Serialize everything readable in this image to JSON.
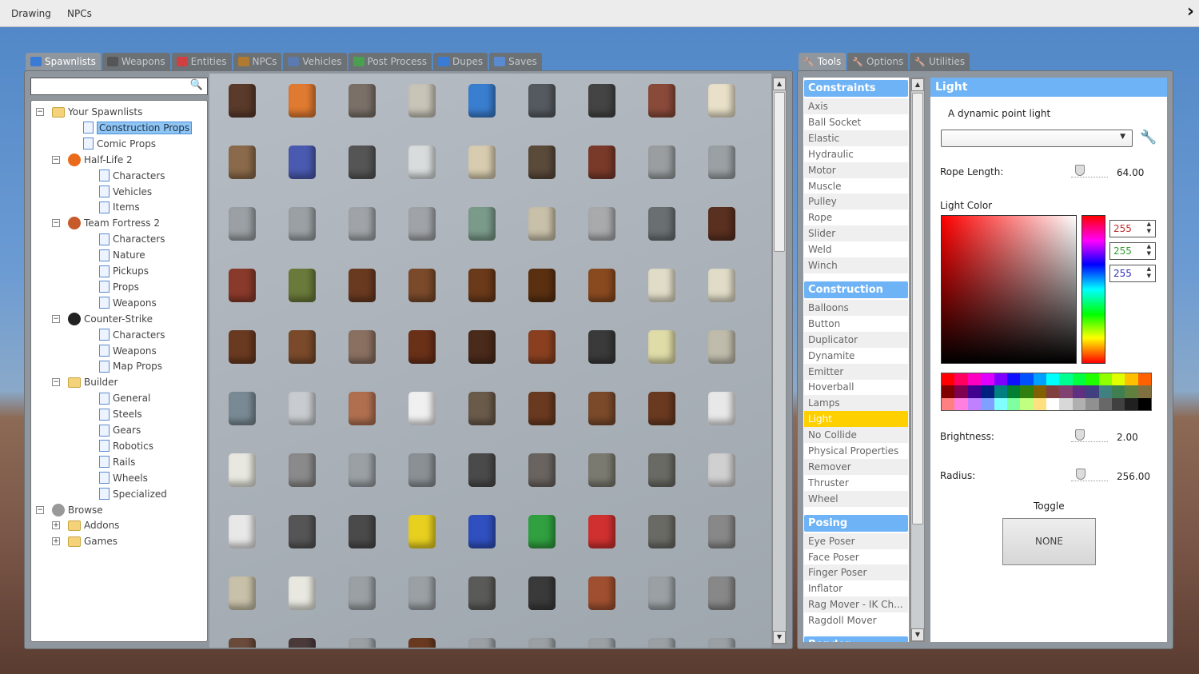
{
  "topbar": {
    "items": [
      "Drawing",
      "NPCs"
    ],
    "chevron": "chevron-right-icon"
  },
  "left_tabs": [
    {
      "label": "Spawnlists",
      "icon": "grid-icon",
      "color": "#3a7bd5",
      "active": true
    },
    {
      "label": "Weapons",
      "icon": "gun-icon",
      "color": "#555555"
    },
    {
      "label": "Entities",
      "icon": "balloon-icon",
      "color": "#d04040"
    },
    {
      "label": "NPCs",
      "icon": "monkey-icon",
      "color": "#b07a30"
    },
    {
      "label": "Vehicles",
      "icon": "car-icon",
      "color": "#5a7ab0"
    },
    {
      "label": "Post Process",
      "icon": "image-icon",
      "color": "#4aa050"
    },
    {
      "label": "Dupes",
      "icon": "dupe-icon",
      "color": "#3a7bd5"
    },
    {
      "label": "Saves",
      "icon": "save-icon",
      "color": "#5a8ad0"
    }
  ],
  "search": {
    "value": "",
    "placeholder": ""
  },
  "tree": [
    {
      "label": "Your Spawnlists",
      "level": 0,
      "icon": "folder",
      "exp": "-"
    },
    {
      "label": "Construction Props",
      "level": 1,
      "icon": "page",
      "selected": true
    },
    {
      "label": "Comic Props",
      "level": 1,
      "icon": "page"
    },
    {
      "label": "Half-Life 2",
      "level": 0.5,
      "icon": "hl2",
      "exp": "-"
    },
    {
      "label": "Characters",
      "level": 2,
      "icon": "page"
    },
    {
      "label": "Vehicles",
      "level": 2,
      "icon": "page"
    },
    {
      "label": "Items",
      "level": 2,
      "icon": "page"
    },
    {
      "label": "Team Fortress 2",
      "level": 0.5,
      "icon": "tf2",
      "exp": "-"
    },
    {
      "label": "Characters",
      "level": 2,
      "icon": "page"
    },
    {
      "label": "Nature",
      "level": 2,
      "icon": "page"
    },
    {
      "label": "Pickups",
      "level": 2,
      "icon": "page"
    },
    {
      "label": "Props",
      "level": 2,
      "icon": "page"
    },
    {
      "label": "Weapons",
      "level": 2,
      "icon": "page"
    },
    {
      "label": "Counter-Strike",
      "level": 0.5,
      "icon": "cs",
      "exp": "-"
    },
    {
      "label": "Characters",
      "level": 2,
      "icon": "page"
    },
    {
      "label": "Weapons",
      "level": 2,
      "icon": "page"
    },
    {
      "label": "Map Props",
      "level": 2,
      "icon": "page"
    },
    {
      "label": "Builder",
      "level": 0.5,
      "icon": "folder",
      "exp": "-"
    },
    {
      "label": "General",
      "level": 2,
      "icon": "page"
    },
    {
      "label": "Steels",
      "level": 2,
      "icon": "page"
    },
    {
      "label": "Gears",
      "level": 2,
      "icon": "page"
    },
    {
      "label": "Robotics",
      "level": 2,
      "icon": "page"
    },
    {
      "label": "Rails",
      "level": 2,
      "icon": "page"
    },
    {
      "label": "Wheels",
      "level": 2,
      "icon": "page"
    },
    {
      "label": "Specialized",
      "level": 2,
      "icon": "page"
    },
    {
      "label": "Browse",
      "level": 0,
      "icon": "gear",
      "exp": "-"
    },
    {
      "label": "Addons",
      "level": 0.5,
      "icon": "folder",
      "exp": "+"
    },
    {
      "label": "Games",
      "level": 0.5,
      "icon": "folder",
      "exp": "+"
    }
  ],
  "prop_colors": [
    [
      "#5a3a2a",
      "#e07a30",
      "#7a7068",
      "#c8c4b8",
      "#3a7ed0",
      "#555a60",
      "#444",
      "#8a4a3a",
      "#e8e0c8"
    ],
    [
      "#8a6a4a",
      "#4a5ab0",
      "#555",
      "#d8dcdc",
      "#d8ccb0",
      "#5a4a3a",
      "#7a3a2a",
      "#9a9ea0",
      "#9aa0a4"
    ],
    [
      "#9aa0a4",
      "#9aa0a4",
      "#a0a4a8",
      "#a0a4a8",
      "#7a9a8a",
      "#c8c0a8",
      "#a8aaac",
      "#6a7072",
      "#5a3020"
    ],
    [
      "#8a3a2a",
      "#6a7a3a",
      "#6a3a20",
      "#7a4a2a",
      "#6a3a1a",
      "#5a3010",
      "#8a4a20",
      "#e0dcc8",
      "#e0dcc8"
    ],
    [
      "#6a3a20",
      "#7a4a2a",
      "#8a7060",
      "#6a3018",
      "#4a2a1a",
      "#8a4020",
      "#3a3a3a",
      "#e0dca8",
      "#c0bcac"
    ],
    [
      "#7a8a94",
      "#c8ccd0",
      "#b07050",
      "#f0f0f0",
      "#6a5a4a",
      "#6a3a20",
      "#7a4a2a",
      "#6a3a20",
      "#e8e8e8"
    ],
    [
      "#e8e8e0",
      "#8a8a8a",
      "#9aa0a4",
      "#8a9094",
      "#4a4a4a",
      "#6a6460",
      "#7a7a70",
      "#6a6a64",
      "#d0d0d0"
    ],
    [
      "#e8e8e8",
      "#555",
      "#4a4a4a",
      "#e8d020",
      "#3050c0",
      "#30a040",
      "#d03030",
      "#6a6a64",
      "#888"
    ],
    [
      "#c8c0a8",
      "#e8e8e0",
      "#9aa0a4",
      "#9aa0a4",
      "#5a5a58",
      "#3a3a3a",
      "#a05030",
      "#9aa0a4",
      "#888"
    ],
    [
      "#6a4a3a",
      "#4a3a3a",
      "#9aa0a4",
      "#6a3a20",
      "#9aa0a4",
      "#9aa0a4",
      "#9aa0a4",
      "#9aa0a4",
      "#9aa0a4"
    ]
  ],
  "right_tabs": [
    {
      "label": "Tools",
      "icon": "wrench-icon",
      "active": true
    },
    {
      "label": "Options",
      "icon": "wrench-icon"
    },
    {
      "label": "Utilities",
      "icon": "utilities-icon"
    }
  ],
  "tool_categories": [
    {
      "label": "Constraints",
      "items": [
        "Axis",
        "Ball Socket",
        "Elastic",
        "Hydraulic",
        "Motor",
        "Muscle",
        "Pulley",
        "Rope",
        "Slider",
        "Weld",
        "Winch"
      ]
    },
    {
      "label": "Construction",
      "items": [
        "Balloons",
        "Button",
        "Duplicator",
        "Dynamite",
        "Emitter",
        "Hoverball",
        "Lamps",
        "Light",
        "No Collide",
        "Physical Properties",
        "Remover",
        "Thruster",
        "Wheel"
      ]
    },
    {
      "label": "Posing",
      "items": [
        "Eye Poser",
        "Face Poser",
        "Finger Poser",
        "Inflator",
        "Rag Mover - IK Ch...",
        "Ragdoll Mover"
      ]
    },
    {
      "label": "Render",
      "items": []
    }
  ],
  "selected_tool": "Light",
  "light": {
    "title": "Light",
    "description": "A dynamic point light",
    "preset_value": "",
    "rope_length_label": "Rope Length:",
    "rope_length": "64.00",
    "rope_length_fraction": 0.1,
    "color_label": "Light Color",
    "r": "255",
    "g": "255",
    "b": "255",
    "brightness_label": "Brightness:",
    "brightness": "2.00",
    "brightness_fraction": 0.1,
    "radius_label": "Radius:",
    "radius": "256.00",
    "radius_fraction": 0.12,
    "toggle_label": "Toggle",
    "toggle_key": "NONE"
  },
  "palette": [
    "#ff0000",
    "#ff0060",
    "#ff00c0",
    "#e000ff",
    "#8000ff",
    "#1010ff",
    "#0050ff",
    "#00a0ff",
    "#00ffff",
    "#00ff90",
    "#00ff40",
    "#20ff00",
    "#90ff00",
    "#e0ff00",
    "#ffc000",
    "#ff6000",
    "#800000",
    "#800050",
    "#400090",
    "#002080",
    "#008080",
    "#008030",
    "#308010",
    "#806000",
    "#804040",
    "#804070",
    "#603080",
    "#404080",
    "#408080",
    "#408050",
    "#608040",
    "#807040",
    "#ff8080",
    "#ff80e0",
    "#c080ff",
    "#80a0ff",
    "#80ffff",
    "#80ffa0",
    "#c0ff80",
    "#ffe080",
    "#ffffff",
    "#d8d8d8",
    "#b0b0b0",
    "#909090",
    "#686868",
    "#404040",
    "#202020",
    "#000000"
  ]
}
